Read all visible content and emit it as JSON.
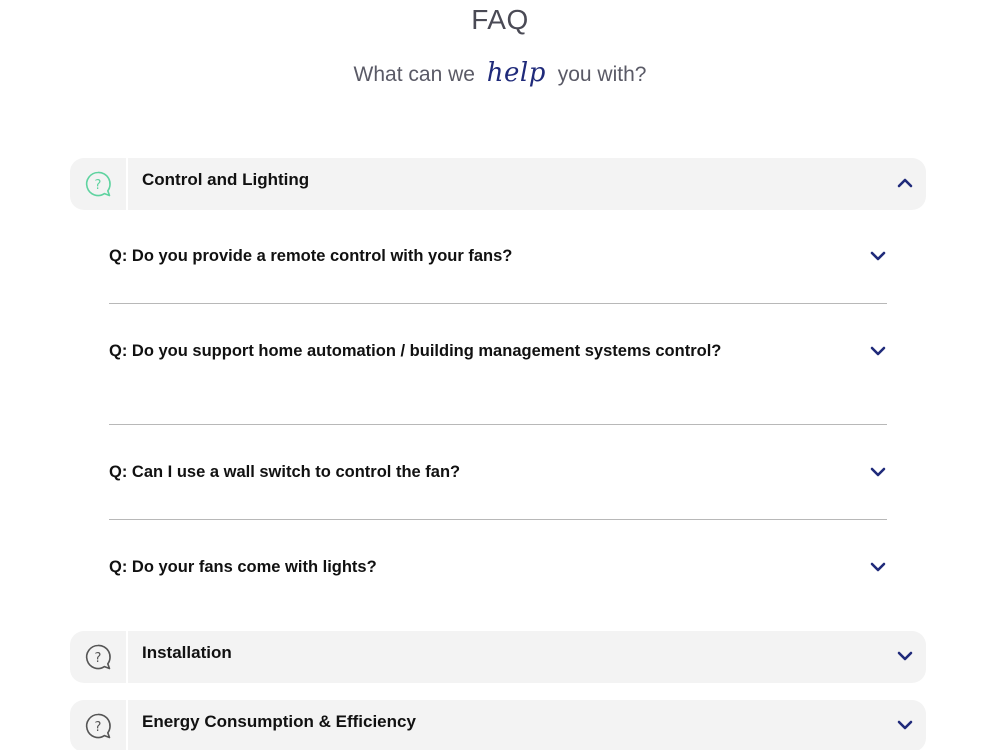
{
  "header": {
    "title": "FAQ",
    "subtitle_before": "What can we",
    "subtitle_script": "help",
    "subtitle_after": "you with?"
  },
  "colors": {
    "accent_navy": "#1f2a7a",
    "active_icon": "#5fd3a0",
    "inactive_icon": "#555555",
    "category_bg": "#f3f3f3"
  },
  "categories": [
    {
      "label": "Control and Lighting",
      "icon": "question-bubble-icon",
      "expanded": true,
      "questions": [
        {
          "text": "Q: Do you provide a remote control with your fans?"
        },
        {
          "text": "Q: Do you support home automation / building management systems control?"
        },
        {
          "text": "Q: Can I use a wall switch to control the fan?"
        },
        {
          "text": "Q: Do your fans come with lights?"
        }
      ]
    },
    {
      "label": "Installation",
      "icon": "question-bubble-icon",
      "expanded": false
    },
    {
      "label": "Energy Consumption & Efficiency",
      "icon": "question-bubble-icon",
      "expanded": false
    }
  ]
}
